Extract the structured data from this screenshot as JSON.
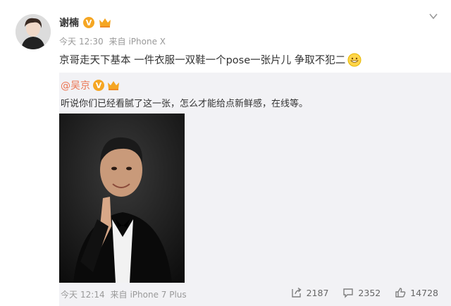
{
  "post": {
    "author": "谢楠",
    "verified_badge": "V",
    "timestamp_day": "今天",
    "timestamp_time": "12:30",
    "source_prefix": "来自",
    "source": "iPhone X",
    "text": "京哥走天下基本 一件衣服一双鞋一个pose一张片儿 争取不犯二",
    "emoji_icon": "grin-emoji-icon"
  },
  "repost": {
    "author": "@吴京",
    "verified_badge": "V",
    "text": "听说你们已经看腻了这一张，怎么才能给点新鲜感，在线等。",
    "timestamp_day": "今天",
    "timestamp_time": "12:14",
    "source_prefix": "来自",
    "source": "iPhone 7 Plus",
    "actions": {
      "forward_count": "2187",
      "comment_count": "2352",
      "like_count": "14728"
    }
  },
  "colors": {
    "accent": "#eb7350",
    "badge": "#f5a623",
    "repost_bg": "#f2f2f5"
  }
}
